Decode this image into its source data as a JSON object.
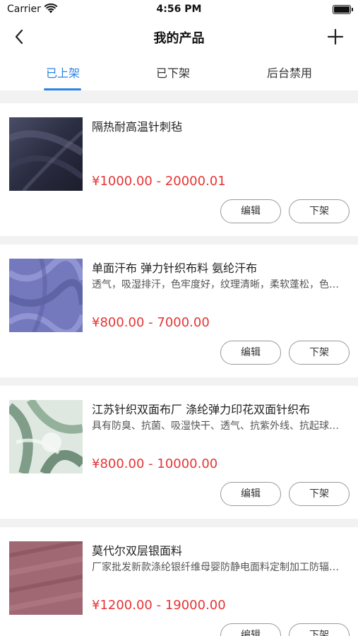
{
  "status_bar": {
    "carrier": "Carrier",
    "time": "4:56 PM"
  },
  "nav": {
    "title": "我的产品"
  },
  "tabs": [
    {
      "label": "已上架",
      "active": true
    },
    {
      "label": "已下架",
      "active": false
    },
    {
      "label": "后台禁用",
      "active": false
    }
  ],
  "colors": {
    "accent": "#2a84e6",
    "price": "#e53535"
  },
  "products": [
    {
      "title": "隔热耐高温针刺毡",
      "description": "",
      "price": "¥1000.00 - 20000.01",
      "edit_label": "编辑",
      "delist_label": "下架",
      "thumb_color": "#2d2f45"
    },
    {
      "title": "单面汗布 弹力针织布料 氨纶汗布",
      "description": "透气，吸湿排汗，色牢度好，纹理清晰，柔软蓬松，色彩鲜艳",
      "price": "¥800.00 - 7000.00",
      "edit_label": "编辑",
      "delist_label": "下架",
      "thumb_color": "#6f74b8"
    },
    {
      "title": "江苏针织双面布厂 涤纶弹力印花双面针织布",
      "description": "具有防臭、抗菌、吸湿快干、透气、抗紫外线、抗起球等功能",
      "price": "¥800.00 - 10000.00",
      "edit_label": "编辑",
      "delist_label": "下架",
      "thumb_color": "#7f9c88"
    },
    {
      "title": "莫代尔双层银面料",
      "description": "厂家批发新款涤纶银纤维母婴防静电面料定制加工防辐射面料",
      "price": "¥1200.00 - 19000.00",
      "edit_label": "编辑",
      "delist_label": "下架",
      "thumb_color": "#9e6470"
    }
  ]
}
